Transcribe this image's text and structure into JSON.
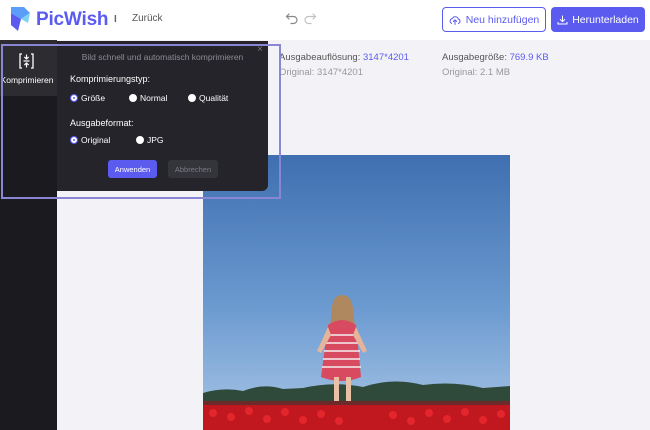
{
  "app": {
    "name": "PicWish"
  },
  "header": {
    "separator": "I",
    "back_label": "Zurück",
    "add_label": "Neu hinzufügen",
    "download_label": "Herunterladen"
  },
  "sidebar": {
    "items": [
      {
        "label": "Komprimieren",
        "icon": "compress-icon",
        "active": true
      }
    ]
  },
  "output_info": {
    "resolution_label": "Ausgabeauflösung:",
    "resolution_value": "3147*4201",
    "resolution_original": "Original: 3147*4201",
    "size_label": "Ausgabegröße:",
    "size_value": "769.9 KB",
    "size_original": "Original: 2.1 MB"
  },
  "popup": {
    "title": "Bild schnell und automatisch komprimieren",
    "compression_type_label": "Komprimierungstyp:",
    "compression_options": [
      {
        "label": "Größe",
        "checked": true
      },
      {
        "label": "Normal",
        "checked": false
      },
      {
        "label": "Qualität",
        "checked": false
      }
    ],
    "format_label": "Ausgabeformat:",
    "format_options": [
      {
        "label": "Original",
        "checked": true
      },
      {
        "label": "JPG",
        "checked": false
      }
    ],
    "apply_label": "Anwenden",
    "cancel_label": "Abbrechen",
    "close_symbol": "×"
  },
  "colors": {
    "accent": "#5b5bf0",
    "sidebar_bg": "#1b1b1f",
    "popup_bg": "#24242a",
    "canvas_bg": "#f3f3f7",
    "highlight": "#8a86d6"
  }
}
